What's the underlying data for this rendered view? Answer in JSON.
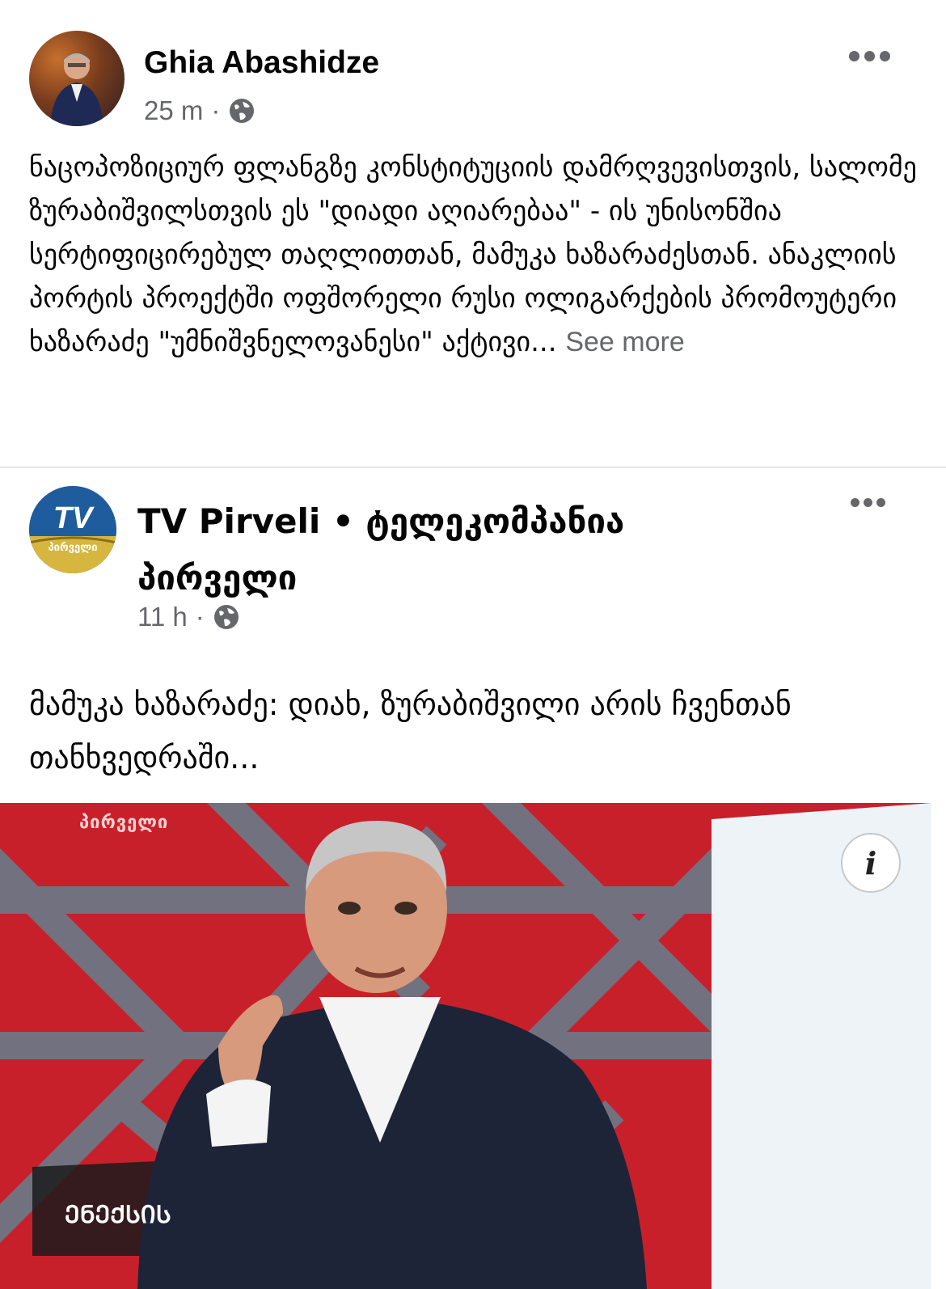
{
  "post": {
    "author": "Ghia Abashidze",
    "time": "25 m",
    "separator": "·",
    "text": "ნაცოპოზიციურ ფლანგზე კონსტიტუციის დამრღვევისთვის, სალომე ზურაბიშვილსთვის ეს \"დიადი აღიარებაა\" - ის უნისონშია სერტიფიცირებულ თაღლითთან, მამუკა ხაზარაძესთან. ანაკლიის პორტის პროექტში ოფშორელი რუსი ოლიგარქების პრომოუტერი ხაზარაძე \"უმნიშვნელოვანესი\" აქტივი...",
    "see_more": "See more",
    "icons": {
      "privacy": "globe-icon",
      "more": "more-options-icon"
    }
  },
  "shared": {
    "page_name": "TV Pirveli • ტელეკომპანია პირველი",
    "time": "11 h",
    "separator": "·",
    "text": "მამუკა ხაზარაძე: დიახ, ზურაბიშვილი არის ჩვენთან თანხვედრაში...",
    "logo_text": "TV",
    "logo_subtext": "პირველი",
    "icons": {
      "privacy": "globe-icon",
      "more": "more-options-icon",
      "info": "info-icon"
    }
  },
  "media": {
    "watermark_top": "პირველი",
    "watermark_bottom": "ᲔᲜᲔᲥᲡᲘᲡ",
    "info_label": "i"
  },
  "colors": {
    "name": "#050505",
    "meta": "#65676b",
    "studio_red": "#d8262c",
    "tv_blue": "#1f5c9e"
  }
}
